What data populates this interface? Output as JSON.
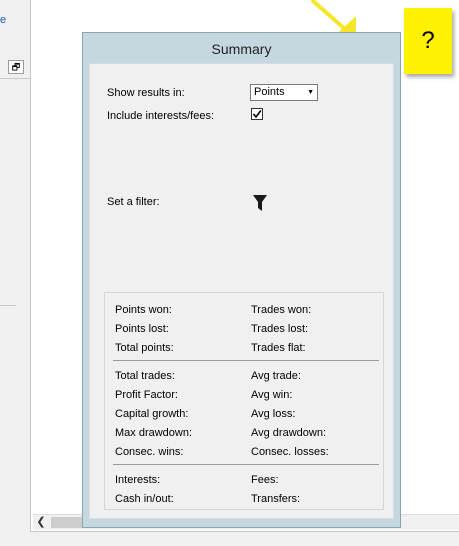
{
  "left_panel": {
    "link_fragment": "e",
    "restore_icon": "restore-window-icon"
  },
  "help_note": {
    "label": "?"
  },
  "pointer_color": "#f5e62a",
  "summary": {
    "title": "Summary",
    "show_results_label": "Show results in:",
    "show_results_value": "Points",
    "include_interests_label": "Include interests/fees:",
    "include_interests_checked": true,
    "filter_label": "Set a filter:",
    "filter_icon": "filter-funnel-icon"
  },
  "stats": {
    "points_won": "Points won:",
    "trades_won": "Trades won:",
    "points_lost": "Points lost:",
    "trades_lost": "Trades lost:",
    "total_points": "Total  points:",
    "trades_flat": "Trades flat:",
    "total_trades": "Total trades:",
    "avg_trade": "Avg trade:",
    "profit_factor": "Profit Factor:",
    "avg_win": "Avg win:",
    "capital_growth": "Capital growth:",
    "avg_loss": "Avg loss:",
    "max_drawdown": "Max drawdown:",
    "avg_drawdown": "Avg drawdown:",
    "consec_wins": "Consec. wins:",
    "consec_losses": "Consec. losses:",
    "interests": "Interests:",
    "fees": "Fees:",
    "cash_in_out": "Cash in/out:",
    "transfers": "Transfers:"
  }
}
